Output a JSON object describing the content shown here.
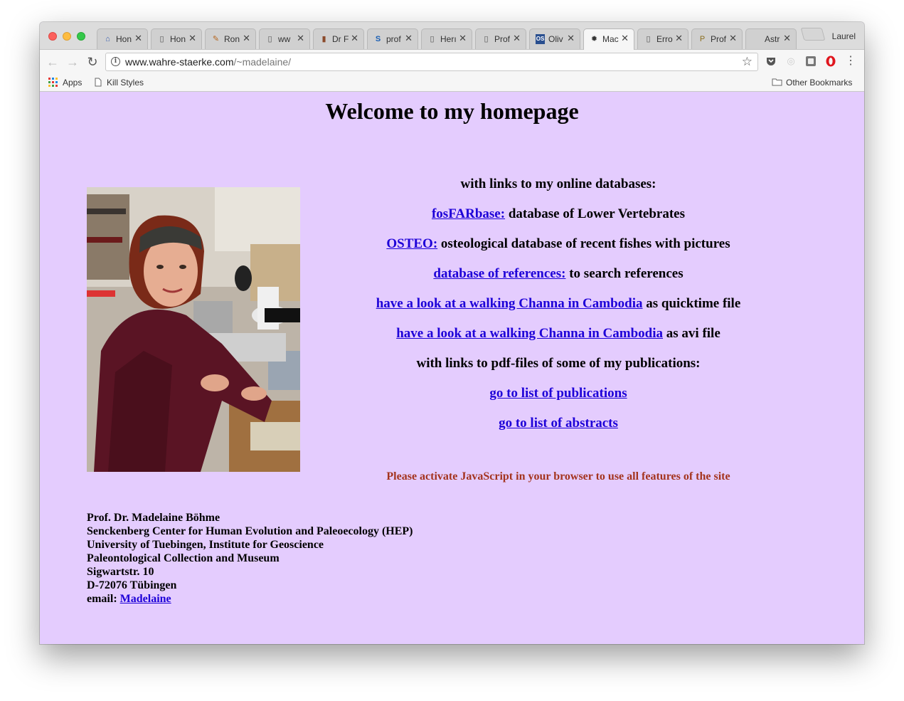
{
  "browser": {
    "profile_name": "Laurel",
    "tabs": [
      {
        "title": "Hon",
        "icon": "museum-icon"
      },
      {
        "title": "Hon",
        "icon": "document-icon"
      },
      {
        "title": "Ron",
        "icon": "drawing-icon"
      },
      {
        "title": "ww",
        "icon": "document-icon"
      },
      {
        "title": "Dr F",
        "icon": "book-icon"
      },
      {
        "title": "prof",
        "icon": "s-logo-icon"
      },
      {
        "title": "Herı",
        "icon": "document-icon"
      },
      {
        "title": "Prof",
        "icon": "document-icon"
      },
      {
        "title": "Oliv",
        "icon": "os-logo-icon"
      },
      {
        "title": "Mac",
        "icon": "gear-icon"
      },
      {
        "title": "Erro",
        "icon": "document-icon"
      },
      {
        "title": "Prof",
        "icon": "purdue-icon"
      },
      {
        "title": "Astr",
        "icon": "blank-icon"
      }
    ],
    "active_tab_index": 9,
    "url_domain": "www.wahre-staerke.com",
    "url_path": "/~madelaine/",
    "bookmarks": {
      "apps": "Apps",
      "kill_styles": "Kill Styles",
      "other": "Other Bookmarks"
    }
  },
  "page": {
    "title": "Welcome to my homepage",
    "databases_intro": "with links to my online databases:",
    "fosfarbase_link": "fosFARbase:",
    "fosfarbase_text": " database of Lower Vertebrates",
    "osteo_link": "OSTEO:",
    "osteo_text": " osteological database of recent fishes with pictures",
    "references_link": "database of references:",
    "references_text": " to search references",
    "channa_link_1": "have a look at a walking Channa in Cambodia",
    "channa_text_1": " as quicktime file",
    "channa_link_2": "have a look at a walking Channa in Cambodia",
    "channa_text_2": " as avi file",
    "publications_intro": "with links to pdf-files of some of my publications:",
    "publications_link": "go to list of publications",
    "abstracts_link": "go to list of abstracts",
    "javascript_notice": "Please activate JavaScript in your browser to use all features of the site",
    "address": {
      "name": "Prof. Dr. Madelaine Böhme",
      "center": "Senckenberg Center for Human Evolution and Paleoecology (HEP)",
      "university": "University of Tuebingen, Institute for Geoscience",
      "collection": "Paleontological Collection and Museum",
      "street": "Sigwartstr. 10",
      "city": "D-72076 Tübingen",
      "email_label": "email: ",
      "email_link": "Madelaine"
    }
  },
  "colors": {
    "page_background": "#e4ccfe",
    "link": "#1d00d8",
    "notice": "#a4341e"
  }
}
